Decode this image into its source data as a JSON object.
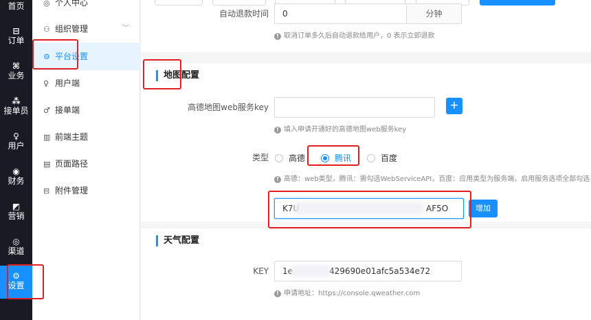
{
  "rail": [
    {
      "label": "首页",
      "icon": "home-icon",
      "glyph": ""
    },
    {
      "label": "订单",
      "icon": "order-icon",
      "glyph": "⊟"
    },
    {
      "label": "业务",
      "icon": "business-icon",
      "glyph": "⌘"
    },
    {
      "label": "接单员",
      "icon": "worker-icon",
      "glyph": "⁂"
    },
    {
      "label": "用户",
      "icon": "user-icon",
      "glyph": "♀"
    },
    {
      "label": "财务",
      "icon": "finance-icon",
      "glyph": "◉"
    },
    {
      "label": "营销",
      "icon": "marketing-icon",
      "glyph": "◩"
    },
    {
      "label": "渠道",
      "icon": "channel-icon",
      "glyph": "◎"
    },
    {
      "label": "设置",
      "icon": "settings-icon",
      "glyph": "⚙"
    }
  ],
  "submenu": [
    {
      "label": "个人中心",
      "icon": "person-center-icon",
      "glyph": "◎"
    },
    {
      "label": "组织管理",
      "icon": "org-icon",
      "glyph": "⚇",
      "chevron": "﹀"
    },
    {
      "label": "平台设置",
      "icon": "platform-settings-icon",
      "glyph": "⚙"
    },
    {
      "label": "用户端",
      "icon": "user-client-icon",
      "glyph": "♀"
    },
    {
      "label": "接单端",
      "icon": "worker-client-icon",
      "glyph": "♂"
    },
    {
      "label": "前端主题",
      "icon": "theme-icon",
      "glyph": "▥"
    },
    {
      "label": "页面路径",
      "icon": "page-path-icon",
      "glyph": "▤"
    },
    {
      "label": "附件管理",
      "icon": "attachment-icon",
      "glyph": "⊟"
    }
  ],
  "refund": {
    "label": "自动退款时间",
    "value": "0",
    "addon": "分钟",
    "hint": "取消订单多久后自动退款给用户，0 表示立即退款"
  },
  "map_section": {
    "title": "地图配置",
    "amap_label": "高德地图web服务key",
    "amap_value": "",
    "plus": "+",
    "amap_hint": "填入申请开通好的高德地图web服务key",
    "type_label": "类型",
    "options": [
      "高德",
      "腾讯",
      "百度"
    ],
    "selected": "腾讯",
    "type_hint": "高德：web类型，腾讯：需勾选WebServiceAPI，百度：应用类型为服务端，启用服务选项全部勾选，目前仅",
    "key_value_start": "K7U",
    "key_value_end": "AF5O",
    "add_label": "增加"
  },
  "weather_section": {
    "title": "天气配置",
    "key_label": "KEY",
    "key_value_start": "1e",
    "key_value_end": "429690e01afc5a534e72",
    "hint": "申请地址：https://console.qweather.com"
  },
  "colors": {
    "accent": "#1890ff",
    "rail_bg": "#191a23",
    "annotation": "#e02020"
  }
}
